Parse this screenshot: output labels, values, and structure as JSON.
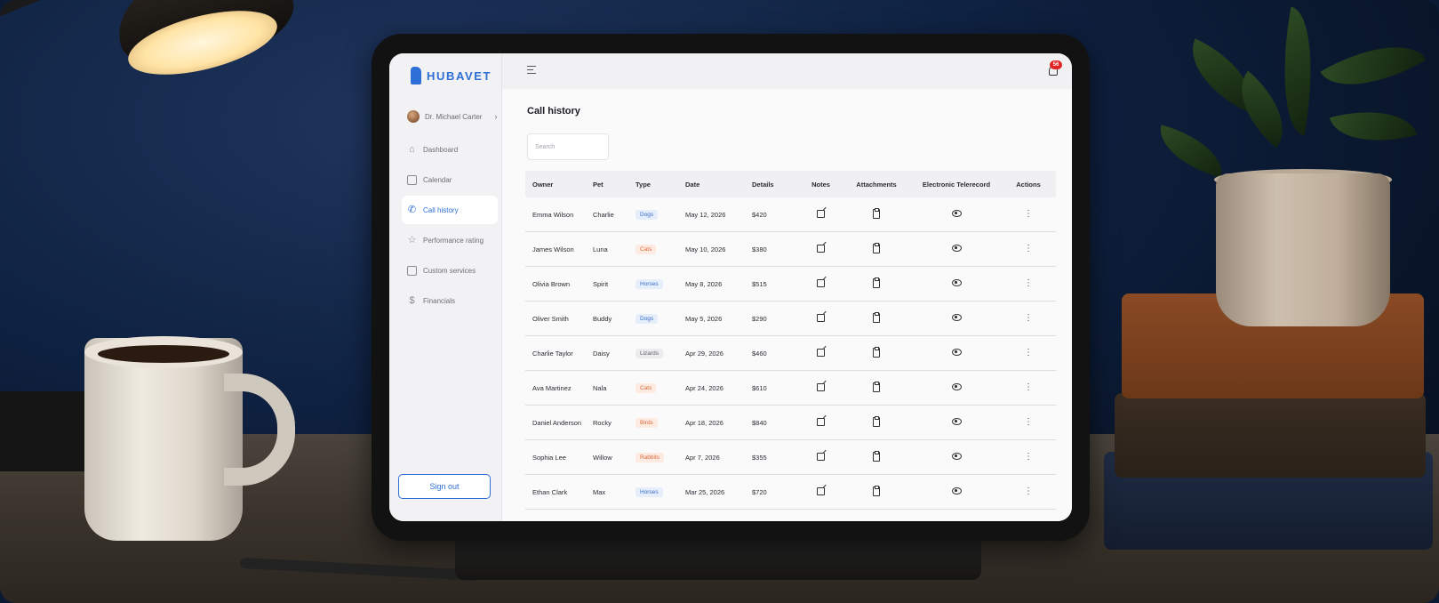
{
  "app": {
    "brand": "HUBAVET"
  },
  "user": {
    "name": "Dr. Michael Carter"
  },
  "sidebar": {
    "items": [
      {
        "label": "Dashboard",
        "icon": "home-icon"
      },
      {
        "label": "Calendar",
        "icon": "calendar-icon"
      },
      {
        "label": "Call history",
        "icon": "phone-icon",
        "active": true
      },
      {
        "label": "Performance rating",
        "icon": "star-icon"
      },
      {
        "label": "Custom services",
        "icon": "clipboard-icon"
      },
      {
        "label": "Financials",
        "icon": "dollar-icon"
      }
    ],
    "signout_label": "Sign out"
  },
  "topbar": {
    "notification_count": "56"
  },
  "main": {
    "title": "Call history",
    "search_placeholder": "Search"
  },
  "table": {
    "headers": [
      "Owner",
      "Pet",
      "Type",
      "Date",
      "Details",
      "Notes",
      "Attachments",
      "Electronic Telerecord",
      "Actions"
    ],
    "rows": [
      {
        "owner": "Emma Wilson",
        "pet": "Charlie",
        "type": "Dogs",
        "type_color": "blue",
        "date": "May 12, 2026",
        "details": "$420"
      },
      {
        "owner": "James Wilson",
        "pet": "Luna",
        "type": "Cats",
        "type_color": "orange",
        "date": "May 10, 2026",
        "details": "$380"
      },
      {
        "owner": "Olivia Brown",
        "pet": "Spirit",
        "type": "Horses",
        "type_color": "blue",
        "date": "May 8, 2026",
        "details": "$515"
      },
      {
        "owner": "Oliver Smith",
        "pet": "Buddy",
        "type": "Dogs",
        "type_color": "blue",
        "date": "May 5, 2026",
        "details": "$290"
      },
      {
        "owner": "Charlie Taylor",
        "pet": "Daisy",
        "type": "Lizards",
        "type_color": "gray",
        "date": "Apr 29, 2026",
        "details": "$460"
      },
      {
        "owner": "Ava Martinez",
        "pet": "Nala",
        "type": "Cats",
        "type_color": "orange",
        "date": "Apr 24, 2026",
        "details": "$610"
      },
      {
        "owner": "Daniel Anderson",
        "pet": "Rocky",
        "type": "Birds",
        "type_color": "orange",
        "date": "Apr 18, 2026",
        "details": "$840"
      },
      {
        "owner": "Sophia Lee",
        "pet": "Willow",
        "type": "Rabbits",
        "type_color": "orange",
        "date": "Apr 7, 2026",
        "details": "$355"
      },
      {
        "owner": "Ethan Clark",
        "pet": "Max",
        "type": "Horses",
        "type_color": "blue",
        "date": "Mar 25, 2026",
        "details": "$720"
      }
    ]
  },
  "colors": {
    "accent": "#2d6fd6",
    "badge": "#e02424"
  }
}
